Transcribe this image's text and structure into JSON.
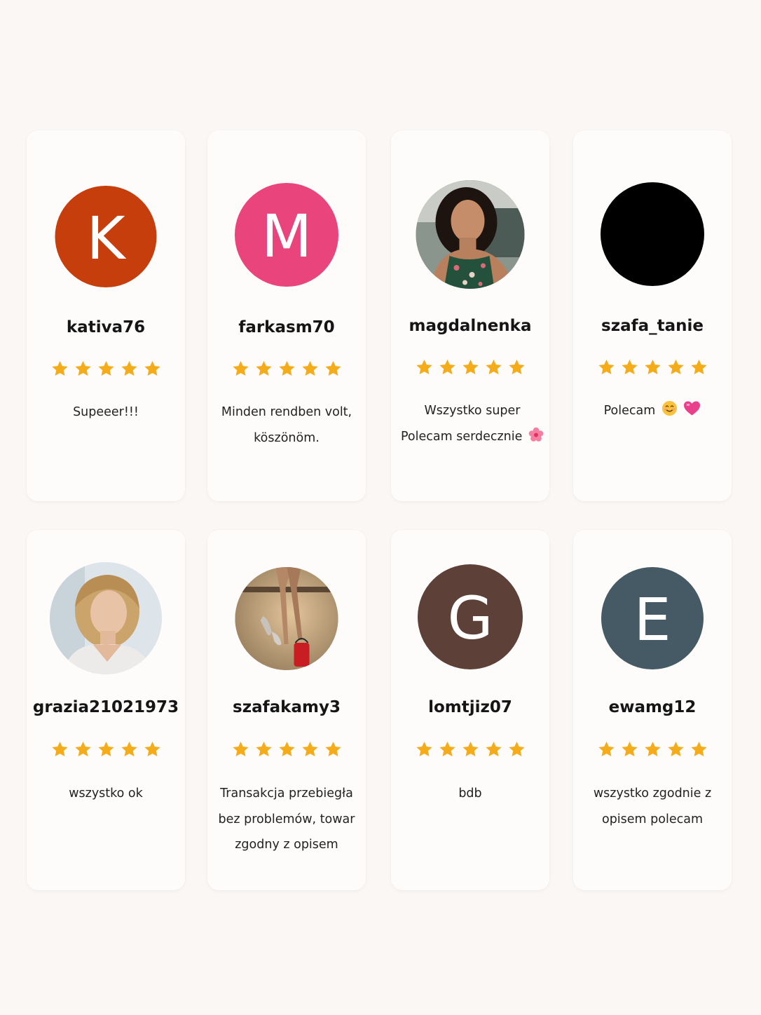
{
  "colors": {
    "page_background": "#faf7f5",
    "card_background": "#fefcfb",
    "star": "#f5ac1b"
  },
  "reviews": [
    {
      "username": "kativa76",
      "avatar": {
        "type": "letter",
        "letter": "K",
        "color": "#c63e0c"
      },
      "rating": 5,
      "text": "Supeeer!!!"
    },
    {
      "username": "farkasm70",
      "avatar": {
        "type": "letter",
        "letter": "M",
        "color": "#e9447c"
      },
      "rating": 5,
      "text": "Minden rendben volt, köszönöm."
    },
    {
      "username": "magdalnenka",
      "avatar": {
        "type": "photo",
        "icon": "user-photo-woman-dark-hair"
      },
      "rating": 5,
      "text": "Wszystko super Polecam serdecznie",
      "emoji": "flower-icon"
    },
    {
      "username": "szafa_tanie",
      "avatar": {
        "type": "solid",
        "color": "#000000"
      },
      "rating": 5,
      "text": "Polecam",
      "emoji": "smile-heart-icon"
    },
    {
      "username": "grazia21021973",
      "avatar": {
        "type": "photo",
        "icon": "user-photo-woman-blonde"
      },
      "rating": 5,
      "text": "wszystko ok"
    },
    {
      "username": "szafakamy3",
      "avatar": {
        "type": "photo",
        "icon": "user-photo-shoes"
      },
      "rating": 5,
      "text": "Transakcja przebiegła bez problemów, towar zgodny z opisem"
    },
    {
      "username": "lomtjiz07",
      "avatar": {
        "type": "letter",
        "letter": "G",
        "color": "#5d4037"
      },
      "rating": 5,
      "text": "bdb"
    },
    {
      "username": "ewamg12",
      "avatar": {
        "type": "letter",
        "letter": "E",
        "color": "#455a64"
      },
      "rating": 5,
      "text": "wszystko zgodnie z opisem polecam"
    }
  ]
}
